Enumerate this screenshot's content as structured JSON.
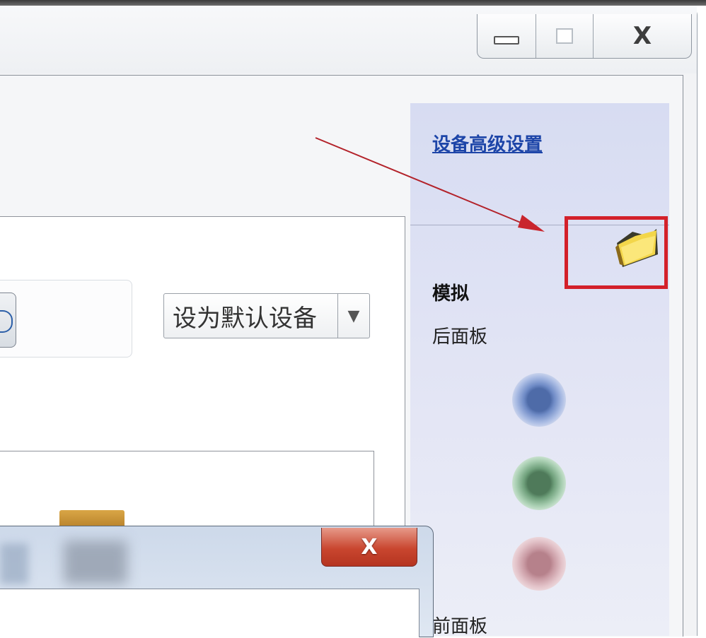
{
  "window": {
    "caption_buttons": {
      "minimize_icon": "minimize-icon",
      "maximize_icon": "maximize-icon",
      "close_glyph": "X"
    }
  },
  "main": {
    "set_default_label": "设为默认设备",
    "set_default_arrow": "▼"
  },
  "right_pane": {
    "advanced_link": "设备高级设置",
    "folder_icon": "folder-icon",
    "analog_label": "模拟",
    "back_panel_label": "后面板",
    "front_panel_label": "前面板",
    "jack_colors": {
      "blue": "#5a76b4",
      "green": "#6b9a77",
      "pink": "#c4949d"
    }
  },
  "annotation": {
    "highlight_color": "#d3202a"
  },
  "dialog": {
    "close_glyph": "X"
  }
}
